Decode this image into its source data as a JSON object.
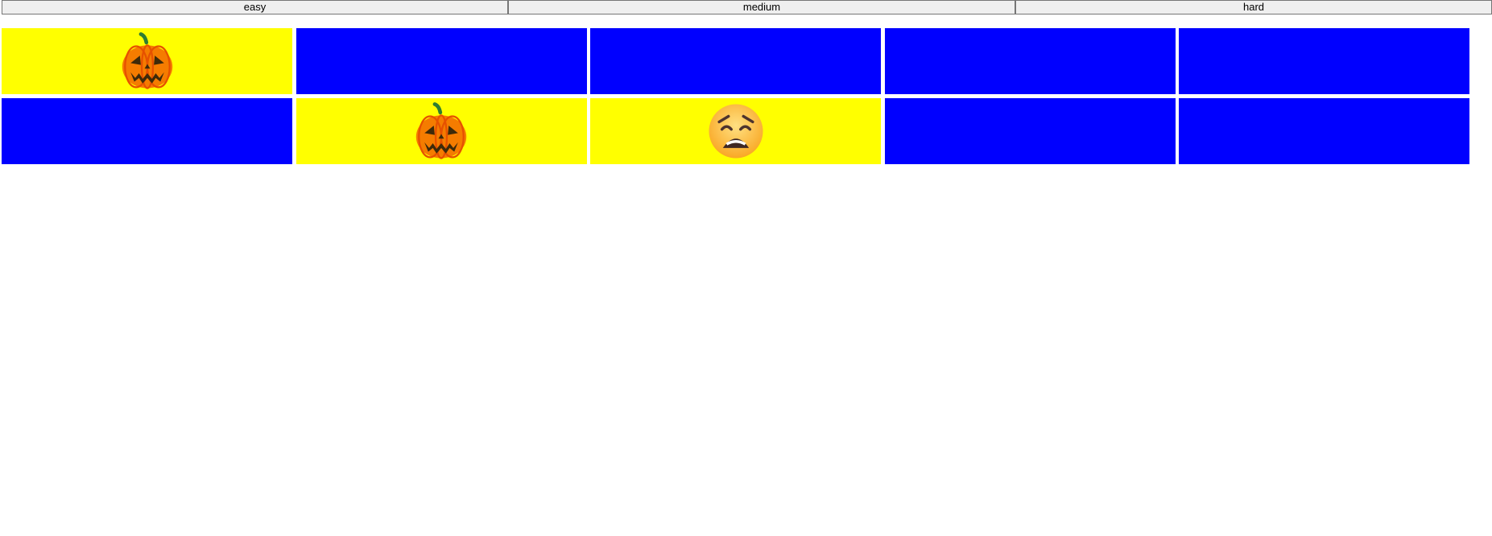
{
  "difficulty": {
    "easy_label": "easy",
    "medium_label": "medium",
    "hard_label": "hard"
  },
  "board": {
    "flipped_color": "#ffff00",
    "hidden_color": "#0000ff",
    "rows": [
      [
        {
          "state": "flipped",
          "icon": "jack-o-lantern-icon"
        },
        {
          "state": "hidden"
        },
        {
          "state": "hidden"
        },
        {
          "state": "hidden"
        },
        {
          "state": "hidden"
        }
      ],
      [
        {
          "state": "hidden"
        },
        {
          "state": "flipped",
          "icon": "jack-o-lantern-icon"
        },
        {
          "state": "flipped",
          "icon": "weary-face-icon"
        },
        {
          "state": "hidden"
        },
        {
          "state": "hidden"
        }
      ]
    ]
  }
}
